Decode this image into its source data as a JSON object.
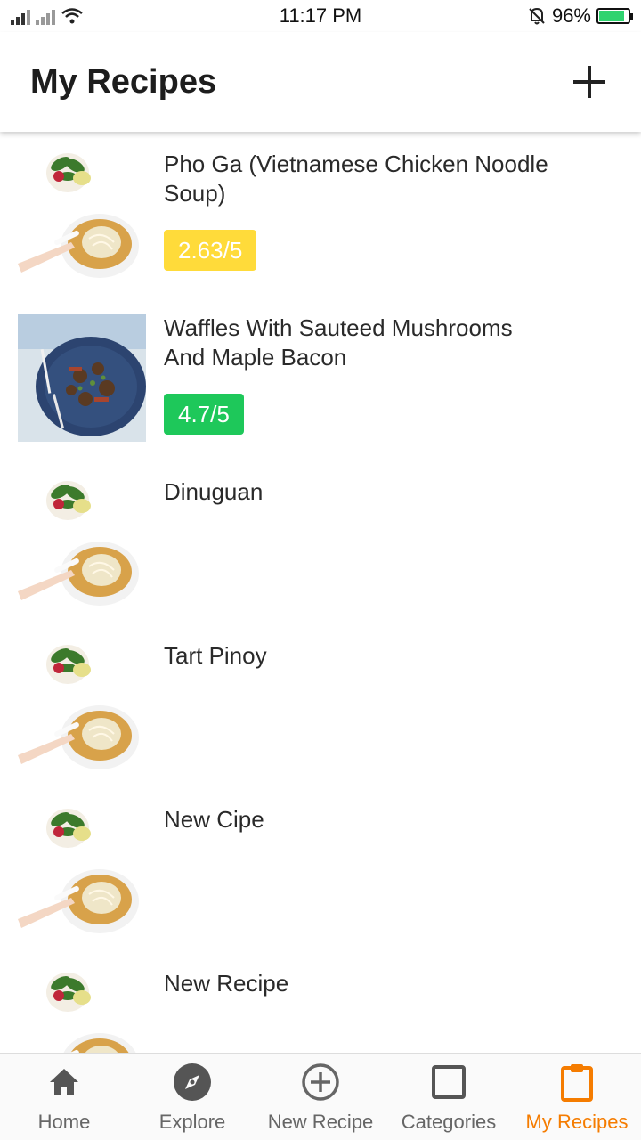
{
  "status": {
    "time": "11:17 PM",
    "battery": "96%",
    "signal_icons": [
      "signal-icon",
      "signal-icon",
      "wifi-icon"
    ],
    "mute_icon": "bell-off-icon"
  },
  "appbar": {
    "title": "My Recipes",
    "add_icon": "plus-icon"
  },
  "recipes": [
    {
      "title": "Pho Ga (Vietnamese Chicken Noodle Soup)",
      "rating": "2.63/5",
      "rating_color": "#ffdb3a",
      "image": "pho-soup"
    },
    {
      "title": "Waffles With Sauteed Mushrooms And Maple Bacon",
      "rating": "4.7/5",
      "rating_color": "#1ec85a",
      "image": "mushroom-plate"
    },
    {
      "title": "Dinuguan",
      "rating": "",
      "image": "pho-soup"
    },
    {
      "title": "Tart Pinoy",
      "rating": "",
      "image": "pho-soup"
    },
    {
      "title": "New Cipe",
      "rating": "",
      "image": "pho-soup"
    },
    {
      "title": "New Recipe",
      "rating": "",
      "image": "pho-soup"
    }
  ],
  "nav": [
    {
      "label": "Home",
      "icon": "home-icon"
    },
    {
      "label": "Explore",
      "icon": "compass-icon"
    },
    {
      "label": "New Recipe",
      "icon": "add-circle-icon"
    },
    {
      "label": "Categories",
      "icon": "square-icon"
    },
    {
      "label": "My Recipes",
      "icon": "clipboard-icon",
      "active": true
    }
  ],
  "colors": {
    "accent": "#f57c00"
  }
}
